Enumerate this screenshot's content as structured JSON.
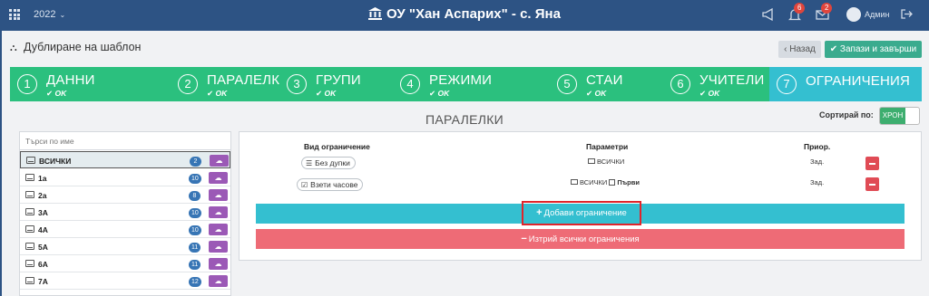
{
  "topbar": {
    "year": "2022",
    "title": "ОУ \"Хан Аспарих\" - с. Яна",
    "notifications_badge": "6",
    "messages_badge": "2",
    "user": "Админ"
  },
  "header": {
    "page_title": "Дублиране на шаблон",
    "back_label": "Назад",
    "save_label": "Запази и завърши"
  },
  "steps": [
    {
      "num": "1",
      "name": "ДАННИ",
      "status": "OK"
    },
    {
      "num": "2",
      "name": "ПАРАЛЕЛКИ",
      "status": "OK"
    },
    {
      "num": "3",
      "name": "ГРУПИ",
      "status": "OK"
    },
    {
      "num": "4",
      "name": "РЕЖИМИ",
      "status": "OK"
    },
    {
      "num": "5",
      "name": "СТАИ",
      "status": "OK"
    },
    {
      "num": "6",
      "name": "УЧИТЕЛИ",
      "status": "OK"
    },
    {
      "num": "7",
      "name": "ОГРАНИЧЕНИЯ",
      "status": ""
    }
  ],
  "section_title": "ПАРАЛЕЛКИ",
  "sort": {
    "label": "Сортирай по:",
    "value": "ХРОН"
  },
  "search": {
    "placeholder": "Търси по име"
  },
  "classes": [
    {
      "label": "ВСИЧКИ",
      "count": "2"
    },
    {
      "label": "1а",
      "count": "10"
    },
    {
      "label": "2а",
      "count": "8"
    },
    {
      "label": "3А",
      "count": "10"
    },
    {
      "label": "4А",
      "count": "10"
    },
    {
      "label": "5А",
      "count": "11"
    },
    {
      "label": "6А",
      "count": "11"
    },
    {
      "label": "7А",
      "count": "12"
    }
  ],
  "constraints_table": {
    "headers": {
      "type": "Вид ограничение",
      "params": "Параметри",
      "priority": "Приор."
    },
    "rows": [
      {
        "type": "Без дупки",
        "param_main": "ВСИЧКИ",
        "param_extra": "",
        "priority": "Зад."
      },
      {
        "type": "Взети часове",
        "param_main": "ВСИЧКИ",
        "param_extra": "Първи",
        "priority": "Зад."
      }
    ]
  },
  "actions": {
    "add_label": "Добави ограничение",
    "delete_all_label": "Изтрий всички ограничения"
  },
  "colors": {
    "topbar": "#2d5384",
    "step_done": "#2bc07e",
    "step_active": "#34bfd0",
    "save": "#3aab8e",
    "danger": "#e04b55",
    "purple": "#9b59b6"
  }
}
